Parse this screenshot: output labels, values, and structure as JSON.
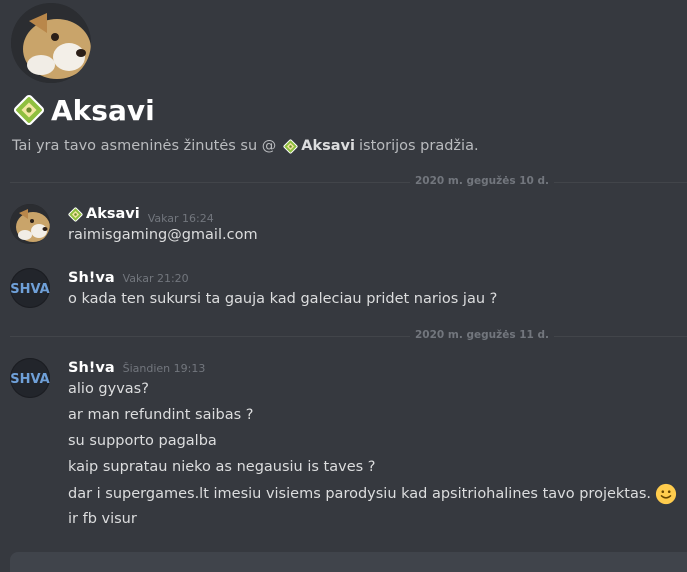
{
  "header": {
    "title": "Aksavi",
    "intro_before": "Tai yra tavo asmeninės žinutės su @",
    "intro_mention": "Aksavi",
    "intro_after": "istorijos pradžia."
  },
  "dividers": [
    {
      "label": "2020 m. gegužės 10 d."
    },
    {
      "label": "2020 m. gegužės 11 d."
    }
  ],
  "messages": [
    {
      "username": "Aksavi",
      "timestamp": "Vakar 16:24",
      "lines": [
        "raimisgaming@gmail.com"
      ],
      "avatar": "dog-avatar"
    },
    {
      "username": "Sh!va",
      "timestamp": "Vakar 21:20",
      "lines": [
        "o kada ten sukursi ta gauja kad galeciau pridet narios jau ?"
      ],
      "avatar": "shiva-avatar"
    },
    {
      "username": "Sh!va",
      "timestamp": "Šiandien 19:13",
      "lines": [
        "alio gyvas?",
        "ar man refundint saibas ?",
        "su supporto pagalba",
        "kaip supratau nieko as negausiu is taves ?",
        "dar i supergames.lt imesiu visiems parodysiu kad apsitriohalines tavo projektas.",
        "ir fb visur"
      ],
      "avatar": "shiva-avatar"
    }
  ],
  "icons": {
    "username_badge": "diamond-badge-icon",
    "emoji_inline": "slightly-smiling-face-icon"
  },
  "colors": {
    "background": "#36393f",
    "text": "#dcddde",
    "muted": "#72767d",
    "divider": "#42454a",
    "username": "#ffffff",
    "smile": "#ffcc4d"
  }
}
